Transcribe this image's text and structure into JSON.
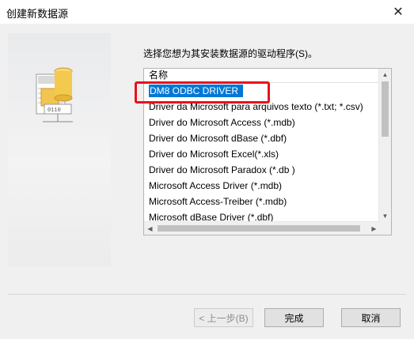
{
  "window": {
    "title": "创建新数据源",
    "close_glyph": "✕"
  },
  "prompt": "选择您想为其安装数据源的驱动程序(S)。",
  "list": {
    "header": "名称",
    "selected_index": 0,
    "items": [
      "DM8 ODBC DRIVER",
      "Driver da Microsoft para arquivos texto (*.txt; *.csv)",
      "Driver do Microsoft Access (*.mdb)",
      "Driver do Microsoft dBase (*.dbf)",
      "Driver do Microsoft Excel(*.xls)",
      "Driver do Microsoft Paradox (*.db )",
      "Microsoft Access Driver (*.mdb)",
      "Microsoft Access-Treiber (*.mdb)",
      "Microsoft dBase Driver (*.dbf)"
    ]
  },
  "buttons": {
    "back": "< 上一步(B)",
    "finish": "完成",
    "cancel": "取消"
  },
  "colors": {
    "selection": "#0078d7",
    "annotation_box": "#e8111b"
  }
}
